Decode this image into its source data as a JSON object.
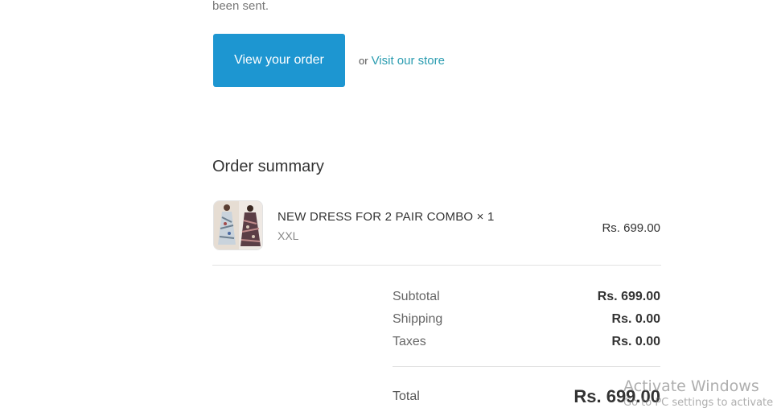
{
  "intro": {
    "tail_text": "been sent."
  },
  "actions": {
    "view_order_label": "View your order",
    "or_text": "or",
    "visit_store_label": "Visit our store"
  },
  "order_summary": {
    "title": "Order summary",
    "items": [
      {
        "name": "NEW DRESS FOR 2 PAIR COMBO × 1",
        "variant": "XXL",
        "price": "Rs. 699.00",
        "image_icon": "dress-thumbnail-icon"
      }
    ],
    "subtotal_label": "Subtotal",
    "subtotal_value": "Rs. 699.00",
    "shipping_label": "Shipping",
    "shipping_value": "Rs. 0.00",
    "taxes_label": "Taxes",
    "taxes_value": "Rs. 0.00",
    "total_label": "Total",
    "total_value": "Rs. 699.00"
  },
  "watermark": {
    "title": "Activate Windows",
    "subtitle": "Go to PC settings to activate"
  },
  "colors": {
    "primary_button": "#1d96d1",
    "link": "#2a9cb0"
  }
}
